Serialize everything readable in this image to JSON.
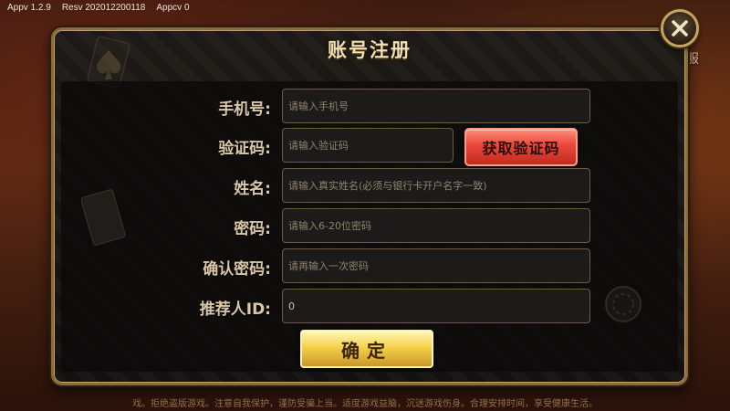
{
  "version_bar": {
    "app_version": "Appv 1.2.9",
    "res_version": "Resv 202012200118",
    "appc_version": "Appcv 0"
  },
  "background": {
    "service_label": "客服",
    "bottom_notice": "戏。拒绝盗版游戏。注意自我保护，谨防受骗上当。适度游戏益脑，沉迷游戏伤身。合理安排时间，享受健康生活。"
  },
  "dialog": {
    "title": "账号注册",
    "fields": [
      {
        "label": "手机号:",
        "placeholder": "请输入手机号",
        "value": ""
      },
      {
        "label": "验证码:",
        "placeholder": "请输入验证码",
        "value": ""
      },
      {
        "label": "姓名:",
        "placeholder": "请输入真实姓名(必须与银行卡开户名字一致)",
        "value": ""
      },
      {
        "label": "密码:",
        "placeholder": "请输入6-20位密码",
        "value": ""
      },
      {
        "label": "确认密码:",
        "placeholder": "请再输入一次密码",
        "value": ""
      },
      {
        "label": "推荐人ID:",
        "placeholder": "",
        "value": "0"
      }
    ],
    "get_code_label": "获取验证码",
    "confirm_label": "确定"
  },
  "icons": {
    "close": "close-icon",
    "spade": "spade-icon",
    "card": "playing-card-icon",
    "chip": "poker-chip-icon"
  },
  "colors": {
    "frame_gold": "#c9a35c",
    "title_gold": "#f3dfb0",
    "code_button_red": "#e9483a",
    "confirm_button_gold": "#f5d24a"
  }
}
